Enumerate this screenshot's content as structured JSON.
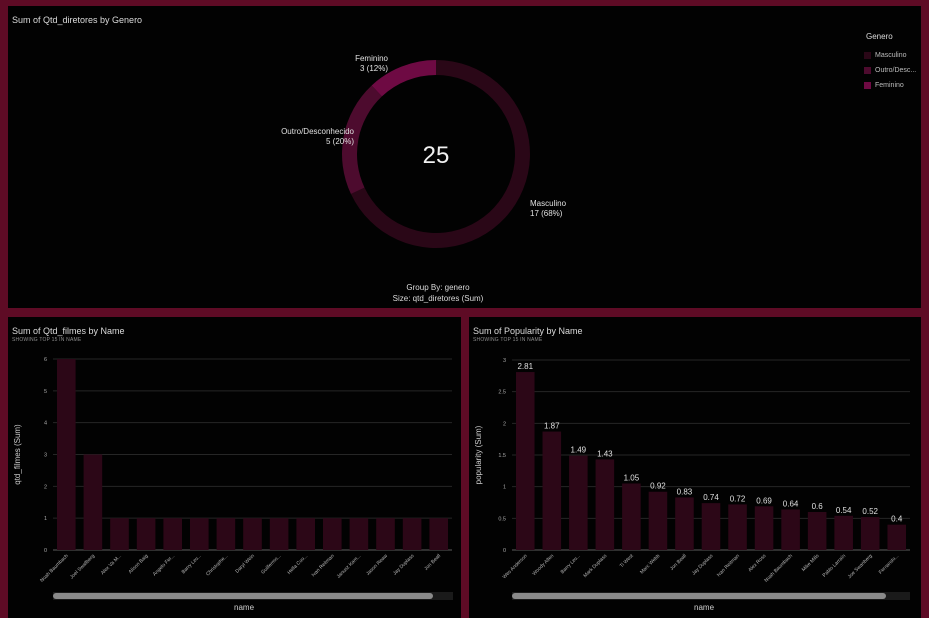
{
  "donut_panel": {
    "title": "Sum of Qtd_diretores by Genero",
    "center_value": "25",
    "group_by": "Group By: genero",
    "size_by": "Size: qtd_diretores (Sum)",
    "legend_title": "Genero",
    "legend": [
      {
        "label": "Masculino",
        "color": "#2a0717"
      },
      {
        "label": "Outro/Desc...",
        "color": "#4d0b2e"
      },
      {
        "label": "Feminino",
        "color": "#6e0a43"
      }
    ],
    "slice_labels": [
      {
        "name": "Masculino",
        "value": "17 (68%)"
      },
      {
        "name": "Outro/Desconhecido",
        "value": "5 (20%)"
      },
      {
        "name": "Feminino",
        "value": "3 (12%)"
      }
    ]
  },
  "films_panel": {
    "title": "Sum of Qtd_filmes by Name",
    "subtitle": "SHOWING TOP 15 IN NAME",
    "x_title": "name",
    "y_title": "qtd_filmes (Sum)"
  },
  "pop_panel": {
    "title": "Sum of Popularity by Name",
    "subtitle": "SHOWING TOP 15 IN NAME",
    "x_title": "name",
    "y_title": "popularity (Sum)"
  },
  "colors": {
    "bar": "#2c0717",
    "frame": "#5e0b25",
    "panel": "#020202"
  },
  "chart_data": [
    {
      "type": "pie",
      "title": "Sum of Qtd_diretores by Genero",
      "categories": [
        "Masculino",
        "Outro/Desconhecido",
        "Feminino"
      ],
      "values": [
        17,
        5,
        3
      ],
      "total": 25,
      "legend_placement": "top-right"
    },
    {
      "type": "bar",
      "title": "Sum of Qtd_filmes by Name",
      "categories": [
        "Noah Baumbach",
        "Joel Swallberg",
        "Alex Va M...",
        "Alison Baig",
        "Angelo Fer...",
        "Barry Lev...",
        "Christophe...",
        "Daryl Wein",
        "Guillermo...",
        "Hella Coo...",
        "Ivan Reitman",
        "Janusz Kam...",
        "Jason Reaw",
        "Jay Duplass",
        "Jon Beall"
      ],
      "values": [
        6,
        3,
        1,
        1,
        1,
        1,
        1,
        1,
        1,
        1,
        1,
        1,
        1,
        1,
        1
      ],
      "ylim": [
        0,
        6
      ],
      "yticks": [
        0,
        1,
        2,
        3,
        4,
        5,
        6
      ],
      "xlabel": "name",
      "ylabel": "qtd_filmes (Sum)",
      "grid": true
    },
    {
      "type": "bar",
      "title": "Sum of Popularity by Name",
      "categories": [
        "Wes Anderson",
        "Woody Allen",
        "Barry Lev...",
        "Mark Duplass",
        "Ti West",
        "Marc Webb",
        "Jon Beall",
        "Jay Duplass",
        "Ivan Reitman",
        "Alex Ross",
        "Noah Baumbach",
        "Mike Mills",
        "Pablo Larraín",
        "Joe Swanberg",
        "Fernando..."
      ],
      "values": [
        2.81,
        1.87,
        1.49,
        1.43,
        1.05,
        0.92,
        0.83,
        0.74,
        0.72,
        0.69,
        0.64,
        0.6,
        0.54,
        0.52,
        0.4
      ],
      "labels": [
        "2.81",
        "1.87",
        "1.49",
        "1.43",
        "1.05",
        "0.92",
        "0.83",
        "0.74",
        "0.72",
        "0.69",
        "0.64",
        "0.6",
        "0.54",
        "0.52",
        "0.4"
      ],
      "ylim": [
        0,
        3
      ],
      "yticks": [
        "0",
        "0.5",
        "1",
        "1.5",
        "2",
        "2.5",
        "3"
      ],
      "xlabel": "name",
      "ylabel": "popularity (Sum)",
      "grid": true
    }
  ]
}
